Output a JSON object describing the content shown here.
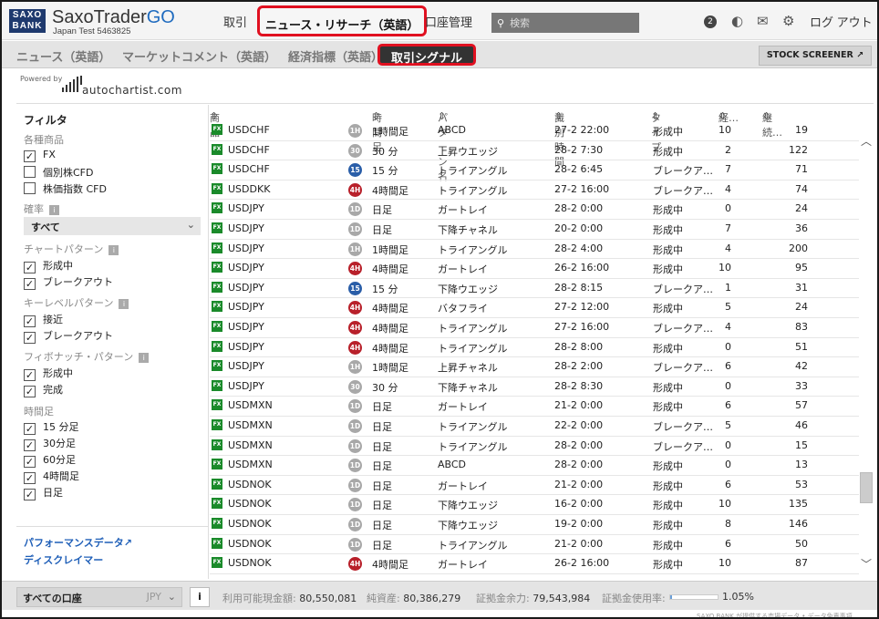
{
  "header": {
    "logo_line1": "SAXO",
    "logo_line2": "BANK",
    "app_name": "SaxoTrader",
    "app_suffix": "GO",
    "account_sub": "Japan Test 5463825",
    "nav_trade": "取引",
    "nav_news": "ニュース・リサーチ（英語）",
    "nav_account": "口座管理",
    "search_placeholder": "検索",
    "notification_count": "2",
    "logout": "ログ アウト"
  },
  "subnav": {
    "tabs": [
      "ニュース（英語）",
      "マーケットコメント（英語）",
      "経済指標（英語）",
      "取引シグナル"
    ],
    "active_tab": "取引シグナル",
    "screener": "STOCK SCREENER"
  },
  "powered": {
    "label": "Powered by",
    "brand": "autochartist.com"
  },
  "filters": {
    "title": "フィルタ",
    "instruments_label": "各種商品",
    "instruments": [
      {
        "label": "FX",
        "checked": true
      },
      {
        "label": "個別株CFD",
        "checked": false
      },
      {
        "label": "株価指数 CFD",
        "checked": false
      }
    ],
    "probability_label": "確率",
    "probability_value": "すべて",
    "chart_pattern_label": "チャートパターン",
    "chart_pattern": [
      {
        "label": "形成中",
        "checked": true
      },
      {
        "label": "ブレークアウト",
        "checked": true
      }
    ],
    "key_level_label": "キーレベルパターン",
    "key_level": [
      {
        "label": "接近",
        "checked": true
      },
      {
        "label": "ブレークアウト",
        "checked": true
      }
    ],
    "fib_label": "フィボナッチ・パターン",
    "fib": [
      {
        "label": "形成中",
        "checked": true
      },
      {
        "label": "完成",
        "checked": true
      }
    ],
    "timeframe_label": "時間足",
    "timeframes": [
      {
        "label": "15 分足",
        "checked": true
      },
      {
        "label": "30分足",
        "checked": true
      },
      {
        "label": "60分足",
        "checked": true
      },
      {
        "label": "4時間足",
        "checked": true
      },
      {
        "label": "日足",
        "checked": true
      }
    ],
    "performance_link": "パフォーマンスデータ",
    "disclaimer_link": "ディスクレイマー"
  },
  "table": {
    "columns": [
      "商品",
      "時間足",
      "パターン名",
      "識別時間",
      "タイプ",
      "経…",
      "継続…"
    ],
    "rows": [
      {
        "badge": "1H",
        "inst": "USDCHF",
        "tf": "1時間足",
        "pattern": "ABCD",
        "time": "27-2 22:00",
        "type": "形成中",
        "c1": "10",
        "c2": "19"
      },
      {
        "badge": "30",
        "inst": "USDCHF",
        "tf": "30 分",
        "pattern": "上昇ウエッジ",
        "time": "28-2 7:30",
        "type": "形成中",
        "c1": "2",
        "c2": "122"
      },
      {
        "badge": "15",
        "inst": "USDCHF",
        "tf": "15 分",
        "pattern": "トライアングル",
        "time": "28-2 6:45",
        "type": "ブレークア…",
        "c1": "7",
        "c2": "71"
      },
      {
        "badge": "4H",
        "inst": "USDDKK",
        "tf": "4時間足",
        "pattern": "トライアングル",
        "time": "27-2 16:00",
        "type": "ブレークア…",
        "c1": "4",
        "c2": "74"
      },
      {
        "badge": "1D",
        "inst": "USDJPY",
        "tf": "日足",
        "pattern": "ガートレイ",
        "time": "28-2 0:00",
        "type": "形成中",
        "c1": "0",
        "c2": "24"
      },
      {
        "badge": "1D",
        "inst": "USDJPY",
        "tf": "日足",
        "pattern": "下降チャネル",
        "time": "20-2 0:00",
        "type": "形成中",
        "c1": "7",
        "c2": "36"
      },
      {
        "badge": "1H",
        "inst": "USDJPY",
        "tf": "1時間足",
        "pattern": "トライアングル",
        "time": "28-2 4:00",
        "type": "形成中",
        "c1": "4",
        "c2": "200"
      },
      {
        "badge": "4H",
        "inst": "USDJPY",
        "tf": "4時間足",
        "pattern": "ガートレイ",
        "time": "26-2 16:00",
        "type": "形成中",
        "c1": "10",
        "c2": "95"
      },
      {
        "badge": "15",
        "inst": "USDJPY",
        "tf": "15 分",
        "pattern": "下降ウエッジ",
        "time": "28-2 8:15",
        "type": "ブレークア…",
        "c1": "1",
        "c2": "31"
      },
      {
        "badge": "4H",
        "inst": "USDJPY",
        "tf": "4時間足",
        "pattern": "バタフライ",
        "time": "27-2 12:00",
        "type": "形成中",
        "c1": "5",
        "c2": "24"
      },
      {
        "badge": "4H",
        "inst": "USDJPY",
        "tf": "4時間足",
        "pattern": "トライアングル",
        "time": "27-2 16:00",
        "type": "ブレークア…",
        "c1": "4",
        "c2": "83"
      },
      {
        "badge": "4H",
        "inst": "USDJPY",
        "tf": "4時間足",
        "pattern": "トライアングル",
        "time": "28-2 8:00",
        "type": "形成中",
        "c1": "0",
        "c2": "51"
      },
      {
        "badge": "1H",
        "inst": "USDJPY",
        "tf": "1時間足",
        "pattern": "上昇チャネル",
        "time": "28-2 2:00",
        "type": "ブレークア…",
        "c1": "6",
        "c2": "42"
      },
      {
        "badge": "30",
        "inst": "USDJPY",
        "tf": "30 分",
        "pattern": "下降チャネル",
        "time": "28-2 8:30",
        "type": "形成中",
        "c1": "0",
        "c2": "33"
      },
      {
        "badge": "1D",
        "inst": "USDMXN",
        "tf": "日足",
        "pattern": "ガートレイ",
        "time": "21-2 0:00",
        "type": "形成中",
        "c1": "6",
        "c2": "57"
      },
      {
        "badge": "1D",
        "inst": "USDMXN",
        "tf": "日足",
        "pattern": "トライアングル",
        "time": "22-2 0:00",
        "type": "ブレークア…",
        "c1": "5",
        "c2": "46"
      },
      {
        "badge": "1D",
        "inst": "USDMXN",
        "tf": "日足",
        "pattern": "トライアングル",
        "time": "28-2 0:00",
        "type": "ブレークア…",
        "c1": "0",
        "c2": "15"
      },
      {
        "badge": "1D",
        "inst": "USDMXN",
        "tf": "日足",
        "pattern": "ABCD",
        "time": "28-2 0:00",
        "type": "形成中",
        "c1": "0",
        "c2": "13"
      },
      {
        "badge": "1D",
        "inst": "USDNOK",
        "tf": "日足",
        "pattern": "ガートレイ",
        "time": "21-2 0:00",
        "type": "形成中",
        "c1": "6",
        "c2": "53"
      },
      {
        "badge": "1D",
        "inst": "USDNOK",
        "tf": "日足",
        "pattern": "下降ウエッジ",
        "time": "16-2 0:00",
        "type": "形成中",
        "c1": "10",
        "c2": "135"
      },
      {
        "badge": "1D",
        "inst": "USDNOK",
        "tf": "日足",
        "pattern": "下降ウエッジ",
        "time": "19-2 0:00",
        "type": "形成中",
        "c1": "8",
        "c2": "146"
      },
      {
        "badge": "1D",
        "inst": "USDNOK",
        "tf": "日足",
        "pattern": "トライアングル",
        "time": "21-2 0:00",
        "type": "形成中",
        "c1": "6",
        "c2": "50"
      },
      {
        "badge": "4H",
        "inst": "USDNOK",
        "tf": "4時間足",
        "pattern": "ガートレイ",
        "time": "26-2 16:00",
        "type": "形成中",
        "c1": "10",
        "c2": "87"
      }
    ],
    "badge_colors": {
      "1H": "#a8a8a8",
      "30": "#a8a8a8",
      "15": "#2a5ea8",
      "4H": "#b8202a",
      "1D": "#a8a8a8"
    },
    "accent": "#e01020"
  },
  "bottom": {
    "account": "すべての口座",
    "currency": "JPY",
    "info": "i",
    "cash_label": "利用可能現金額:",
    "cash_value": "80,550,081",
    "equity_label": "純資産:",
    "equity_value": "80,386,279",
    "margin_label": "証拠金余力:",
    "margin_value": "79,543,984",
    "usage_label": "証拠金使用率:",
    "usage_value": "1.05%",
    "usage_fraction": 0.0105
  },
  "footer_note": "SAXO BANK が提供する市場データ • データ免責事項"
}
